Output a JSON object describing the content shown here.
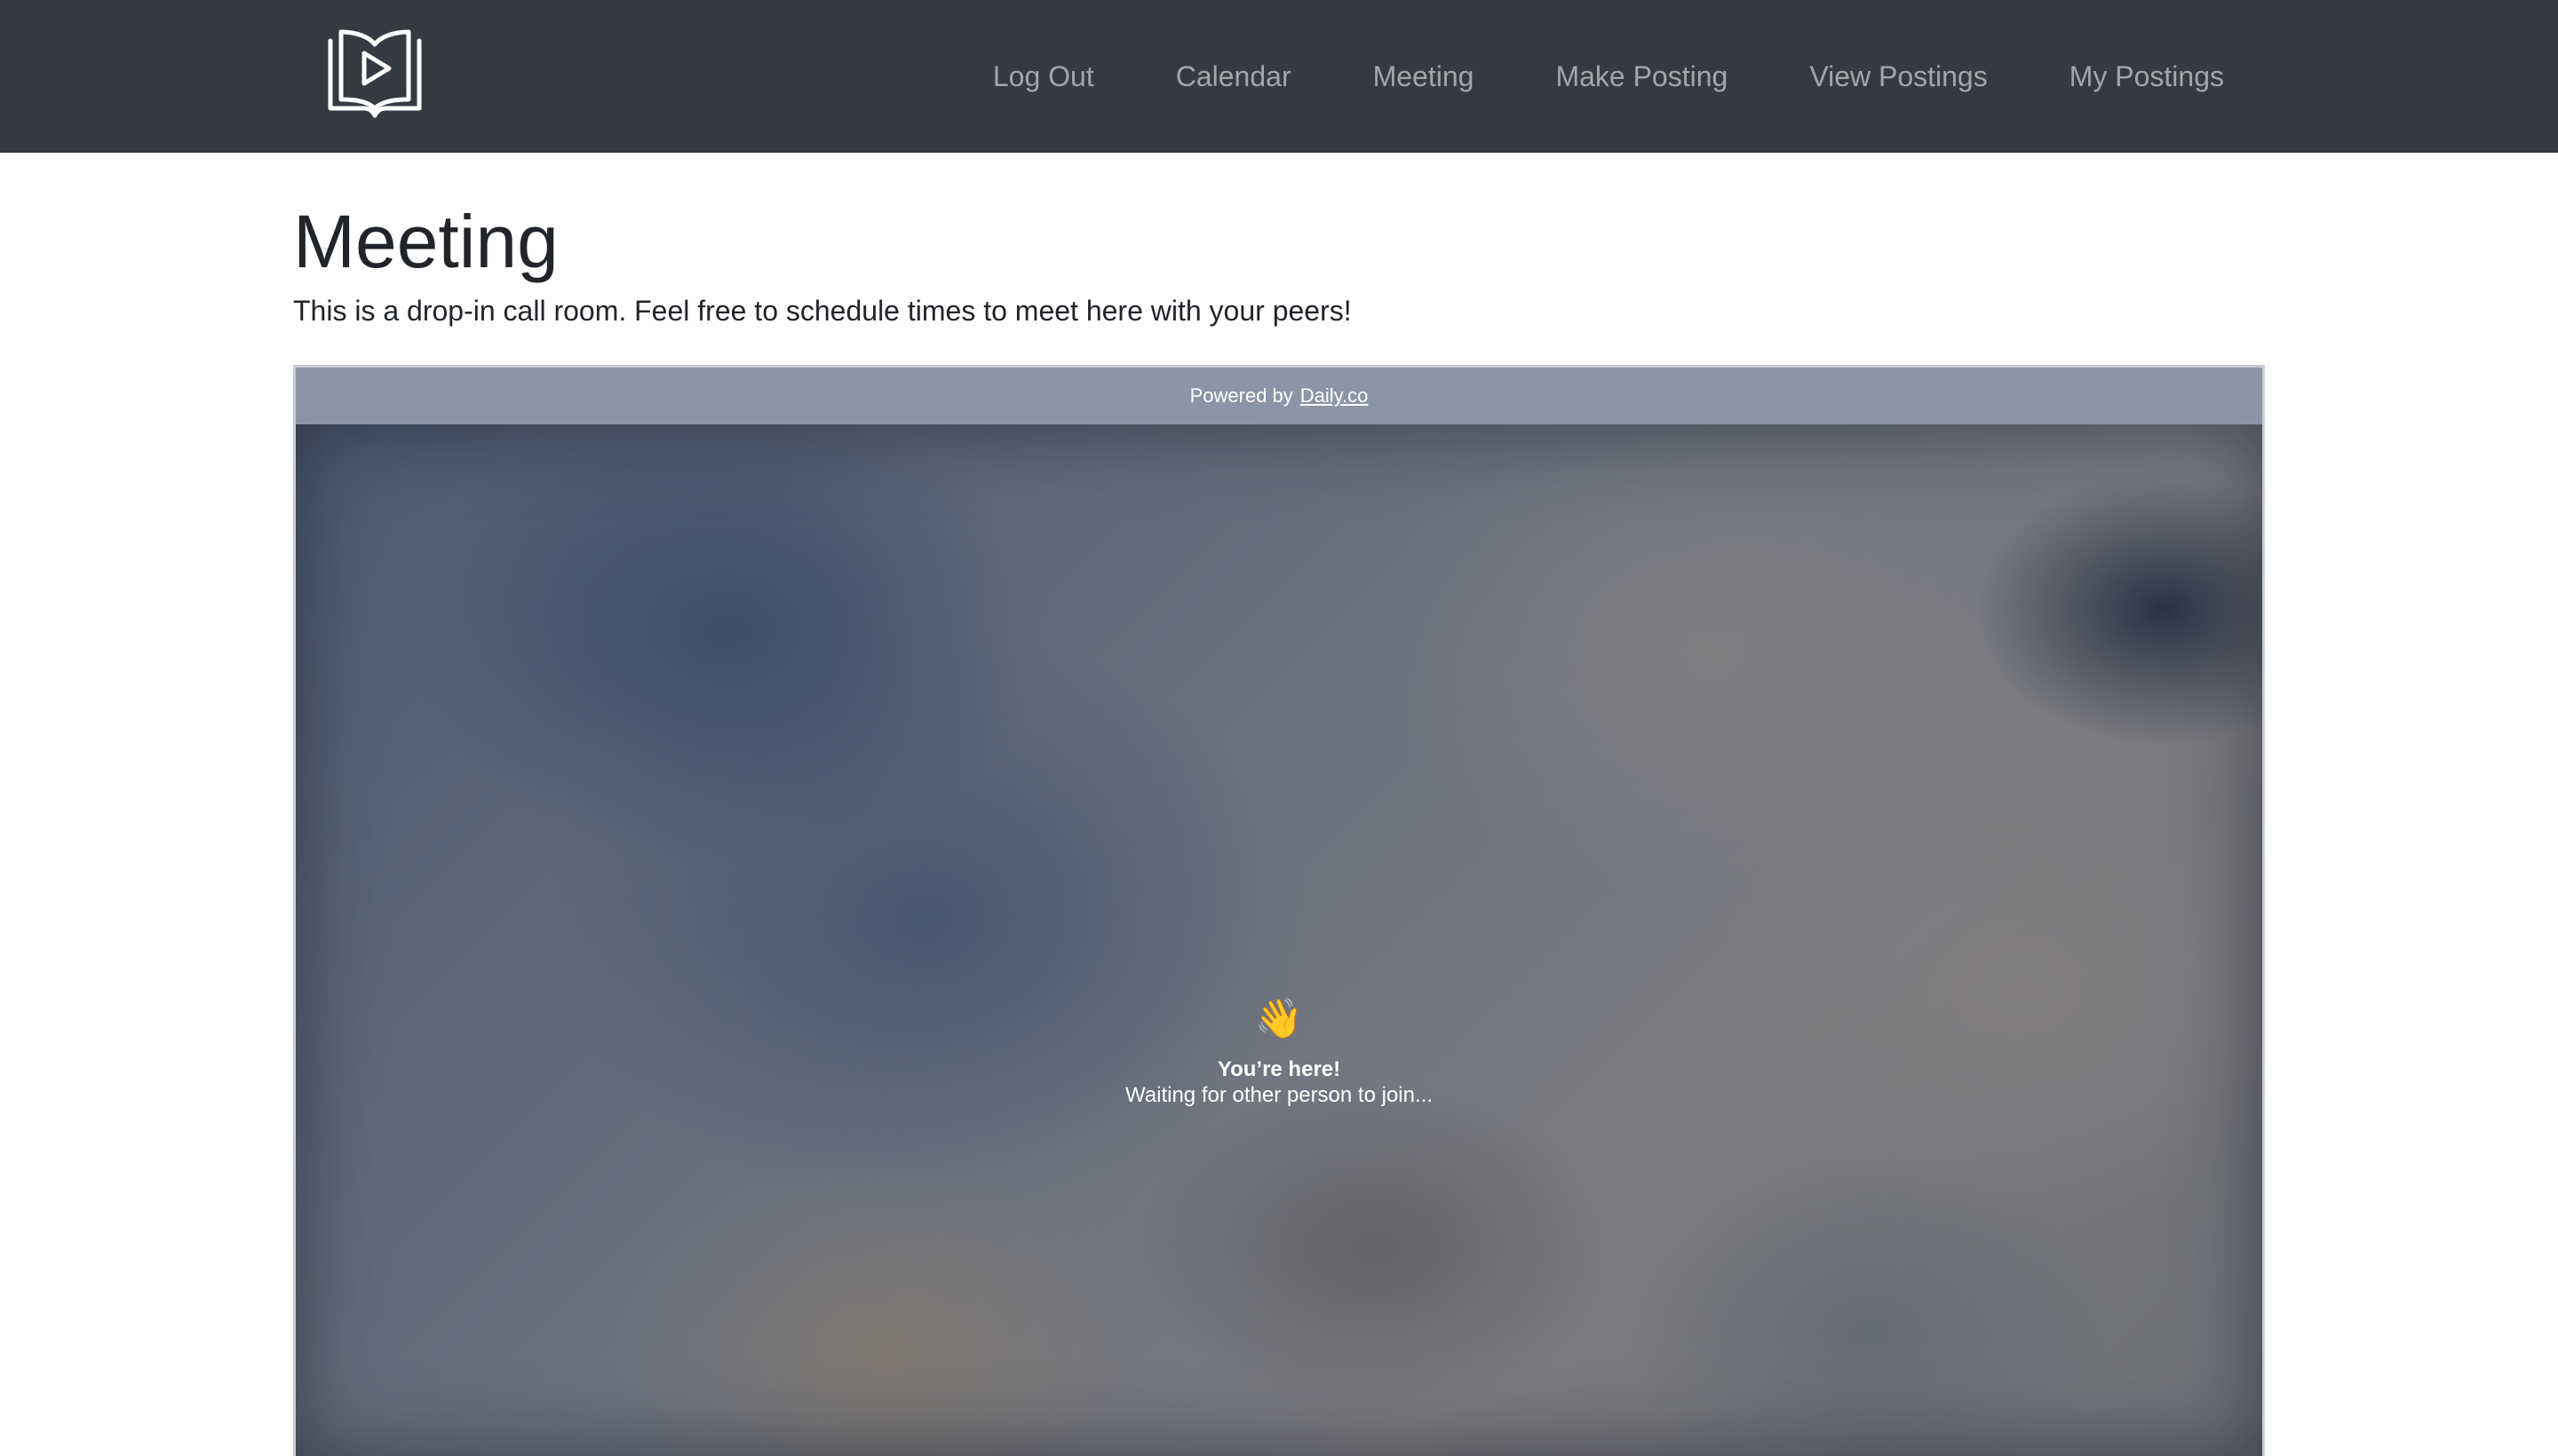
{
  "navbar": {
    "brand_icon": "book-play-icon",
    "links": [
      {
        "label": "Log Out"
      },
      {
        "label": "Calendar"
      },
      {
        "label": "Meeting"
      },
      {
        "label": "Make Posting"
      },
      {
        "label": "View Postings"
      },
      {
        "label": "My Postings"
      }
    ]
  },
  "main": {
    "title": "Meeting",
    "description": "This is a drop-in call room. Feel free to schedule times to meet here with your peers!"
  },
  "call": {
    "powered_prefix": "Powered by",
    "powered_link": "Daily.co",
    "wave_icon": "👋",
    "status_title": "You’re here!",
    "status_sub": "Waiting for other person to join..."
  },
  "colors": {
    "navbar_bg": "#343a40",
    "powered_bar_bg": "#8a96a8"
  }
}
